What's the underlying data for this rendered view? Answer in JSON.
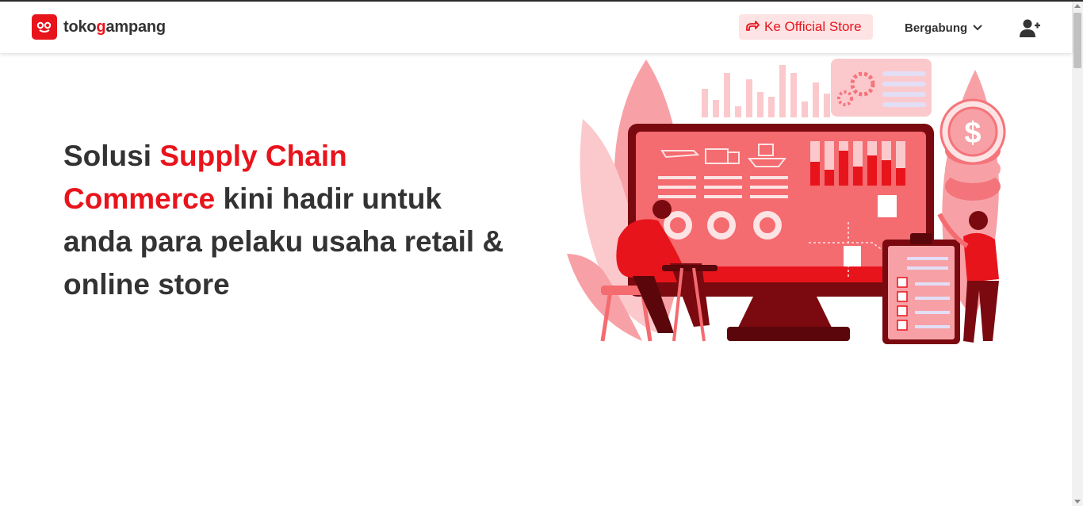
{
  "header": {
    "logo": {
      "text_before": "toko",
      "text_accent": "g",
      "text_after": "ampang",
      "mark": "oo"
    },
    "official_store_label": "Ke Official Store",
    "official_store_icon": "share-arrow-icon",
    "join_label": "Bergabung",
    "join_icon": "chevron-down-icon",
    "user_add_icon": "user-add-icon"
  },
  "hero": {
    "part1": "Solusi ",
    "highlight1": "Supply Chain",
    "highlight2": "Commerce",
    "part2": " kini hadir untuk anda para pelaku usaha retail & online store"
  },
  "colors": {
    "brand": "#e8141c",
    "brand_light": "#fde3e4",
    "text": "#333333"
  }
}
